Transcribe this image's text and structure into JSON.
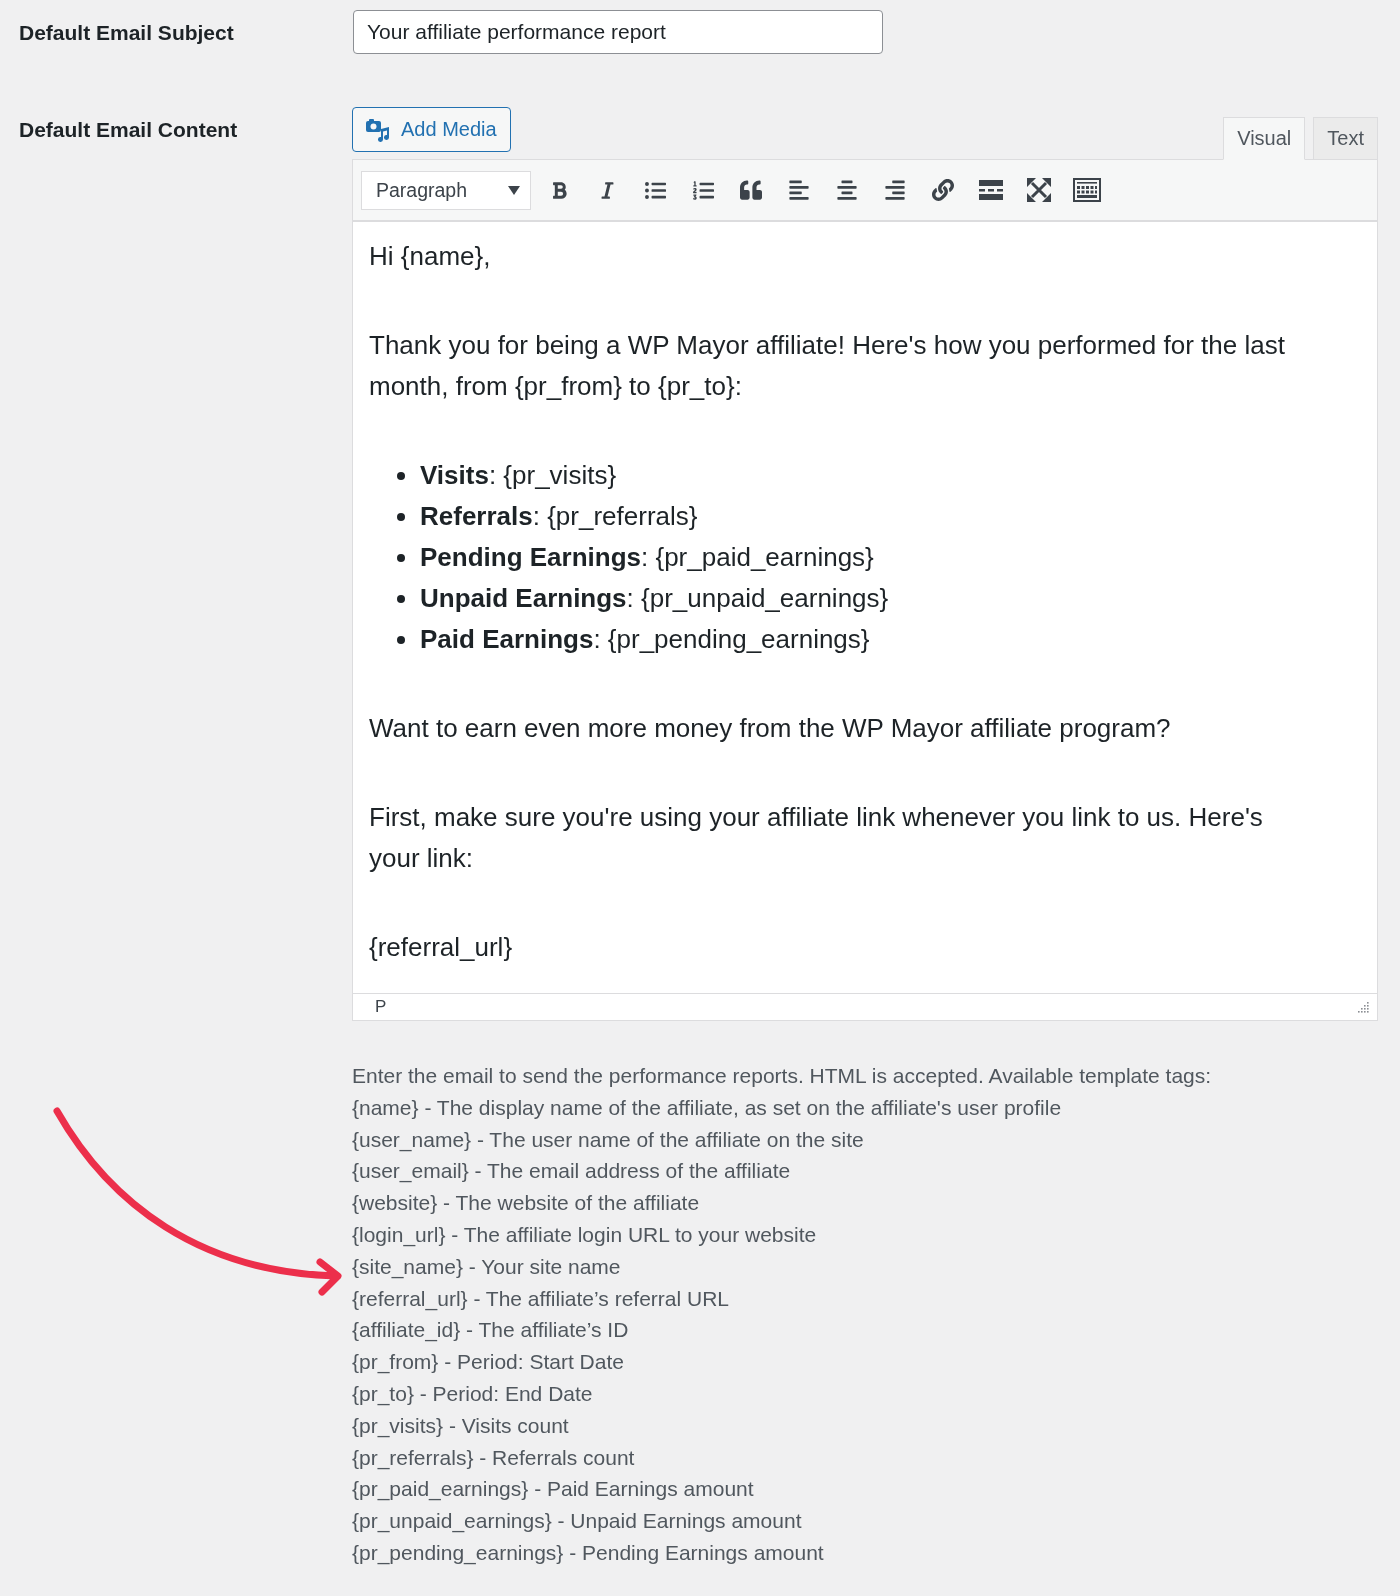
{
  "subject": {
    "label": "Default Email Subject",
    "value": "Your affiliate performance report"
  },
  "content": {
    "label": "Default Email Content",
    "add_media": "Add Media",
    "tabs": [
      {
        "label": "Visual",
        "selected": true
      },
      {
        "label": "Text",
        "selected": false
      }
    ],
    "format_select": "Paragraph",
    "body": [
      {
        "kind": "paragraph",
        "text": "Hi {name},"
      },
      {
        "kind": "paragraph",
        "text": "Thank you for being a WP Mayor affiliate! Here's how you performed for the last month, from {pr_from} to {pr_to}:"
      },
      {
        "kind": "list",
        "items": [
          "**Visits**: {pr_visits}",
          "**Referrals**: {pr_referrals}",
          "**Pending Earnings**: {pr_paid_earnings}",
          "**Unpaid Earnings**: {pr_unpaid_earnings}",
          "**Paid Earnings**: {pr_pending_earnings}"
        ]
      },
      {
        "kind": "paragraph",
        "text": "Want to earn even more money from the WP Mayor affiliate program?"
      },
      {
        "kind": "paragraph",
        "text": "First, make sure you're using your affiliate link whenever you link to us. Here's your link:"
      },
      {
        "kind": "paragraph",
        "text": "{referral_url}"
      }
    ],
    "element_path": "P"
  },
  "help": {
    "intro": "Enter the email to send the performance reports. HTML is accepted. Available template tags:",
    "tags": [
      "{name} - The display name of the affiliate, as set on the affiliate's user profile",
      "{user_name} - The user name of the affiliate on the site",
      "{user_email} - The email address of the affiliate",
      "{website} - The website of the affiliate",
      "{login_url} - The affiliate login URL to your website",
      "{site_name} - Your site name",
      "{referral_url} - The affiliate’s referral URL",
      "{affiliate_id} - The affiliate’s ID",
      "{pr_from} - Period: Start Date",
      "{pr_to} - Period: End Date",
      "{pr_visits} - Visits count",
      "{pr_referrals} - Referrals count",
      "{pr_paid_earnings} - Paid Earnings amount",
      "{pr_unpaid_earnings} - Unpaid Earnings amount",
      "{pr_pending_earnings} - Pending Earnings amount"
    ]
  }
}
